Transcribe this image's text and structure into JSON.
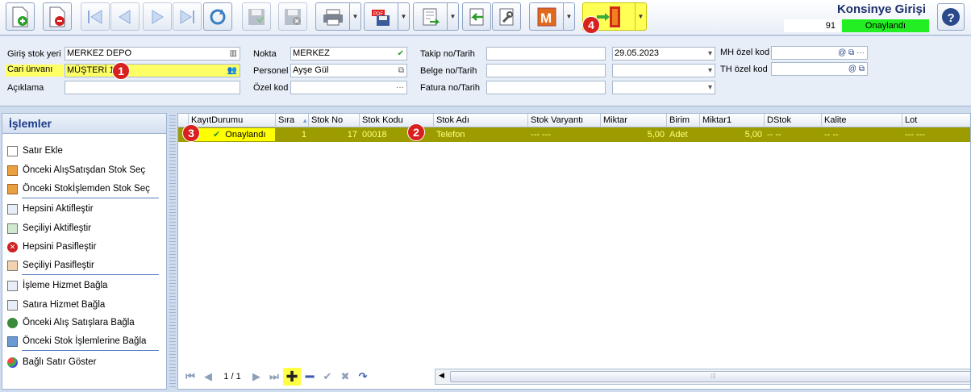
{
  "header": {
    "title": "Konsinye Girişi",
    "record_no": "91",
    "status": "Onaylandı"
  },
  "badges": [
    "1",
    "2",
    "3",
    "4"
  ],
  "form": {
    "giris_stok_yeri": {
      "label": "Giriş stok yeri",
      "value": "MERKEZ DEPO"
    },
    "cari_unvani": {
      "label": "Cari ünvanı",
      "value": "MÜŞTERİ 1"
    },
    "aciklama": {
      "label": "Açıklama",
      "value": ""
    },
    "nokta": {
      "label": "Nokta",
      "value": "MERKEZ"
    },
    "personel": {
      "label": "Personel",
      "value": "Ayşe Gül"
    },
    "ozel_kod": {
      "label": "Özel kod",
      "value": ""
    },
    "takip_no": {
      "label": "Takip no/Tarih",
      "value": "",
      "date": "29.05.2023"
    },
    "belge_no": {
      "label": "Belge no/Tarih",
      "value": "",
      "date": ""
    },
    "fatura_no": {
      "label": "Fatura no/Tarih",
      "value": "",
      "date": ""
    },
    "mh_ozel_kod": {
      "label": "MH özel kod",
      "value": ""
    },
    "th_ozel_kod": {
      "label": "TH özel kod",
      "value": ""
    }
  },
  "left_panel": {
    "title": "İşlemler",
    "actions": [
      "Satır Ekle",
      "Önceki AlışSatışdan Stok Seç",
      "Önceki Stokİşlemden Stok Seç",
      "Hepsini Aktifleştir",
      "Seçiliyi Aktifleştir",
      "Hepsini Pasifleştir",
      "Seçiliyi Pasifleştir",
      "İşleme Hizmet Bağla",
      "Satıra Hizmet Bağla",
      "Önceki Alış Satışlara Bağla",
      "Önceki Stok İşlemlerine Bağla",
      "Bağlı Satır Göster"
    ]
  },
  "grid": {
    "columns": [
      "KayıtDurumu",
      "Sıra",
      "Stok No",
      "Stok Kodu",
      "Stok Adı",
      "Stok Varyantı",
      "Miktar",
      "Birim",
      "Miktar1",
      "DStok",
      "Kalite",
      "Lot"
    ],
    "rows": [
      {
        "durum": "Onaylandı",
        "sira": "1",
        "stok_no": "17",
        "stok_kodu": "00018",
        "stok_adi": "Telefon",
        "varyant": "--- ---",
        "miktar": "5,00",
        "birim": "Adet",
        "miktar1": "5,00",
        "dstok": "-- --",
        "kalite": "-- --",
        "lot": "--- ---"
      }
    ]
  },
  "pager": {
    "text": "1 / 1"
  },
  "colors": {
    "approved": "#22ee22",
    "row_selected": "#9c9c00",
    "highlight": "#ffff66",
    "badge": "#d8201e"
  }
}
